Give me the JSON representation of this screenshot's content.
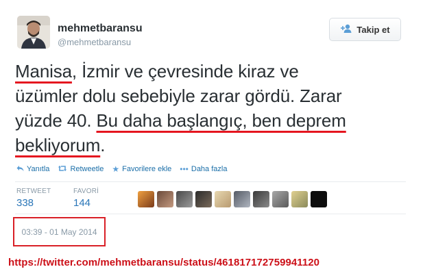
{
  "profile": {
    "display_name": "mehmetbaransu",
    "screen_name": "@mehmetbaransu"
  },
  "follow_button": {
    "label": "Takip et",
    "icon": "follow-user-plus-icon"
  },
  "tweet": {
    "line1": {
      "p1": "Manisa",
      "p2": ", İzmir ve çevresinde kiraz ve"
    },
    "line2": "üzümler dolu sebebiyle zarar gördü. Zarar",
    "line3": {
      "p1": "yüzde 40. ",
      "p2": "Bu daha başlangıç, ben deprem"
    },
    "line4": {
      "p1": "bekliyorum",
      "p2": "."
    }
  },
  "actions": [
    {
      "label": "Yanıtla",
      "icon": "reply-icon"
    },
    {
      "label": "Retweetle",
      "icon": "retweet-icon"
    },
    {
      "label": "Favorilere ekle",
      "icon": "star-icon"
    },
    {
      "label": "Daha fazla",
      "icon": "more-dots-icon"
    }
  ],
  "stats": {
    "retweet_label": "RETWEET",
    "retweet_count": "338",
    "favori_label": "FAVORİ",
    "favori_count": "144"
  },
  "timestamp": "03:39 - 01 May 2014",
  "source_url": "https://twitter.com/mehmetbaransu/status/461817172759941120",
  "colors": {
    "link": "#2a76b8",
    "annotation_red": "#d91f26",
    "muted": "#8899a6"
  }
}
